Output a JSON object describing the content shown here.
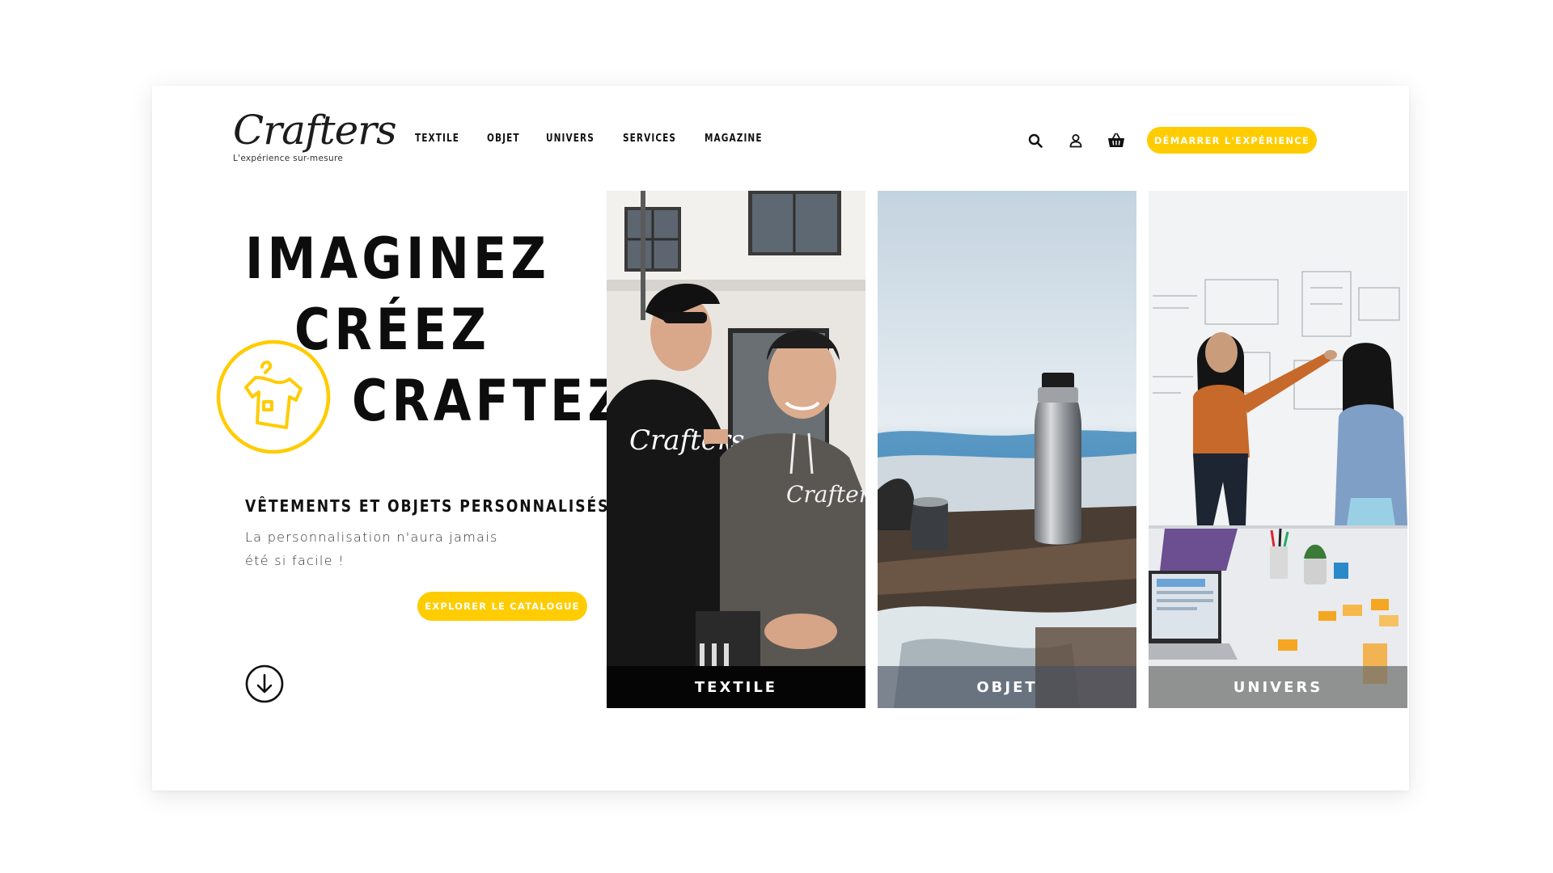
{
  "brand": {
    "logo_text": "Crafters",
    "tagline": "L'expérience sur-mesure",
    "accent_color": "#ffcc00"
  },
  "nav": {
    "items": [
      {
        "label": "TEXTILE"
      },
      {
        "label": "OBJET"
      },
      {
        "label": "UNIVERS"
      },
      {
        "label": "SERVICES"
      },
      {
        "label": "MAGAZINE"
      }
    ]
  },
  "header_icons": [
    "search-icon",
    "user-icon",
    "basket-icon"
  ],
  "header_cta": "DÉMARRER L'EXPÉRIENCE",
  "hero": {
    "line1": "IMAGINEZ",
    "line2": "CRÉEZ",
    "line3": "CRAFTEZ",
    "subheading": "VÊTEMENTS ET OBJETS PERSONNALISÉS.",
    "description_line1": "La personnalisation n'aura jamais",
    "description_line2": "été si facile !",
    "cta": "EXPLORER LE CATALOGUE"
  },
  "cards": [
    {
      "label": "TEXTILE",
      "shirt_print": "Crafters",
      "hoodie_print": "Crafters"
    },
    {
      "label": "OBJET"
    },
    {
      "label": "UNIVERS"
    }
  ]
}
